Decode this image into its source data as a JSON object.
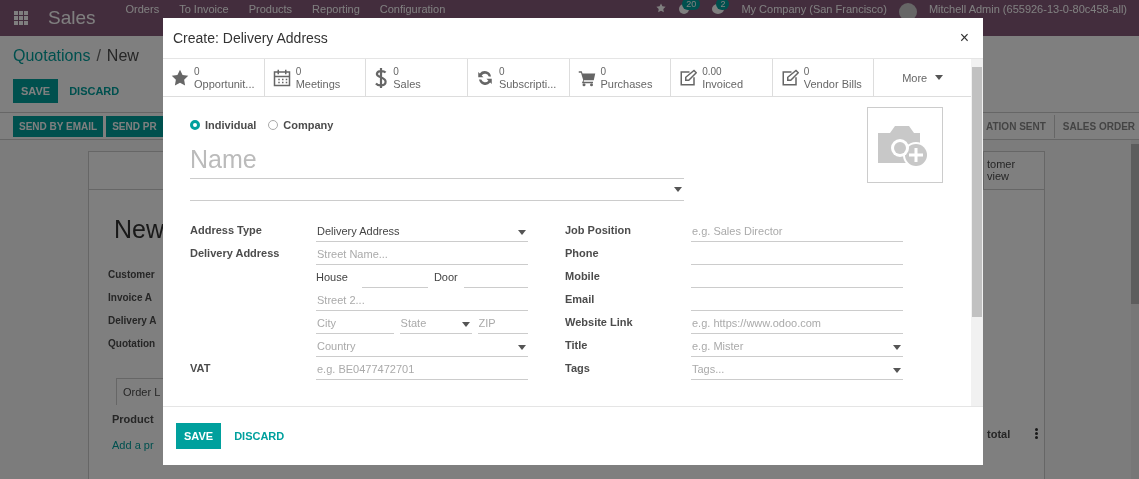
{
  "navbar": {
    "app": "Sales",
    "menus": [
      "Orders",
      "To Invoice",
      "Products",
      "Reporting",
      "Configuration"
    ],
    "badges": [
      "20",
      "2"
    ],
    "company": "My Company (San Francisco)",
    "user": "Mitchell Admin (655926-13-0-80c458-all)"
  },
  "breadcrumb": {
    "parent": "Quotations",
    "separator": "/",
    "current": "New"
  },
  "form_buttons": [
    "SAVE",
    "DISCARD"
  ],
  "status_buttons": [
    "SEND BY EMAIL",
    "SEND PR"
  ],
  "stages": [
    "ATION SENT",
    "SALES ORDER"
  ],
  "sheet": {
    "smart_button": [
      "tomer",
      "view"
    ],
    "title": "New",
    "fields": [
      "Customer",
      "Invoice A",
      "Delivery A",
      "Quotation"
    ],
    "tab": "Order L",
    "columns": [
      "Product",
      "total"
    ],
    "add_line": "Add a pr"
  },
  "dialog": {
    "title": "Create: Delivery Address",
    "close": "×",
    "smart_buttons": [
      {
        "kind": "star",
        "value": "0",
        "label": "Opportunit..."
      },
      {
        "kind": "calendar",
        "value": "0",
        "label": "Meetings"
      },
      {
        "kind": "dollar",
        "value": "0",
        "label": "Sales"
      },
      {
        "kind": "refresh",
        "value": "0",
        "label": "Subscripti..."
      },
      {
        "kind": "cart",
        "value": "0",
        "label": "Purchases"
      },
      {
        "kind": "edit",
        "value": "0.00",
        "label": "Invoiced"
      },
      {
        "kind": "edit",
        "value": "0",
        "label": "Vendor Bills"
      }
    ],
    "more": "More",
    "company_type": [
      {
        "label": "Individual",
        "selected": true
      },
      {
        "label": "Company",
        "selected": false
      }
    ],
    "name_placeholder": "Name",
    "left_fields": [
      {
        "label": "Address Type",
        "kind": "select",
        "value": "Delivery Address"
      },
      {
        "label": "Delivery Address",
        "kind": "address",
        "street": {
          "placeholder": "Street Name..."
        },
        "house": {
          "label": "House"
        },
        "door": {
          "label": "Door"
        },
        "street2": {
          "placeholder": "Street 2..."
        },
        "city": {
          "placeholder": "City"
        },
        "state": {
          "placeholder": "State"
        },
        "zip": {
          "placeholder": "ZIP"
        },
        "country": {
          "placeholder": "Country"
        }
      },
      {
        "label": "VAT",
        "kind": "text",
        "placeholder": "e.g. BE0477472701"
      }
    ],
    "right_fields": [
      {
        "label": "Job Position",
        "kind": "text",
        "placeholder": "e.g. Sales Director"
      },
      {
        "label": "Phone",
        "kind": "text"
      },
      {
        "label": "Mobile",
        "kind": "text"
      },
      {
        "label": "Email",
        "kind": "text"
      },
      {
        "label": "Website Link",
        "kind": "text",
        "placeholder": "e.g. https://www.odoo.com"
      },
      {
        "label": "Title",
        "kind": "select",
        "placeholder": "e.g. Mister"
      },
      {
        "label": "Tags",
        "kind": "select",
        "placeholder": "Tags..."
      }
    ],
    "buttons": [
      "SAVE",
      "DISCARD"
    ]
  }
}
